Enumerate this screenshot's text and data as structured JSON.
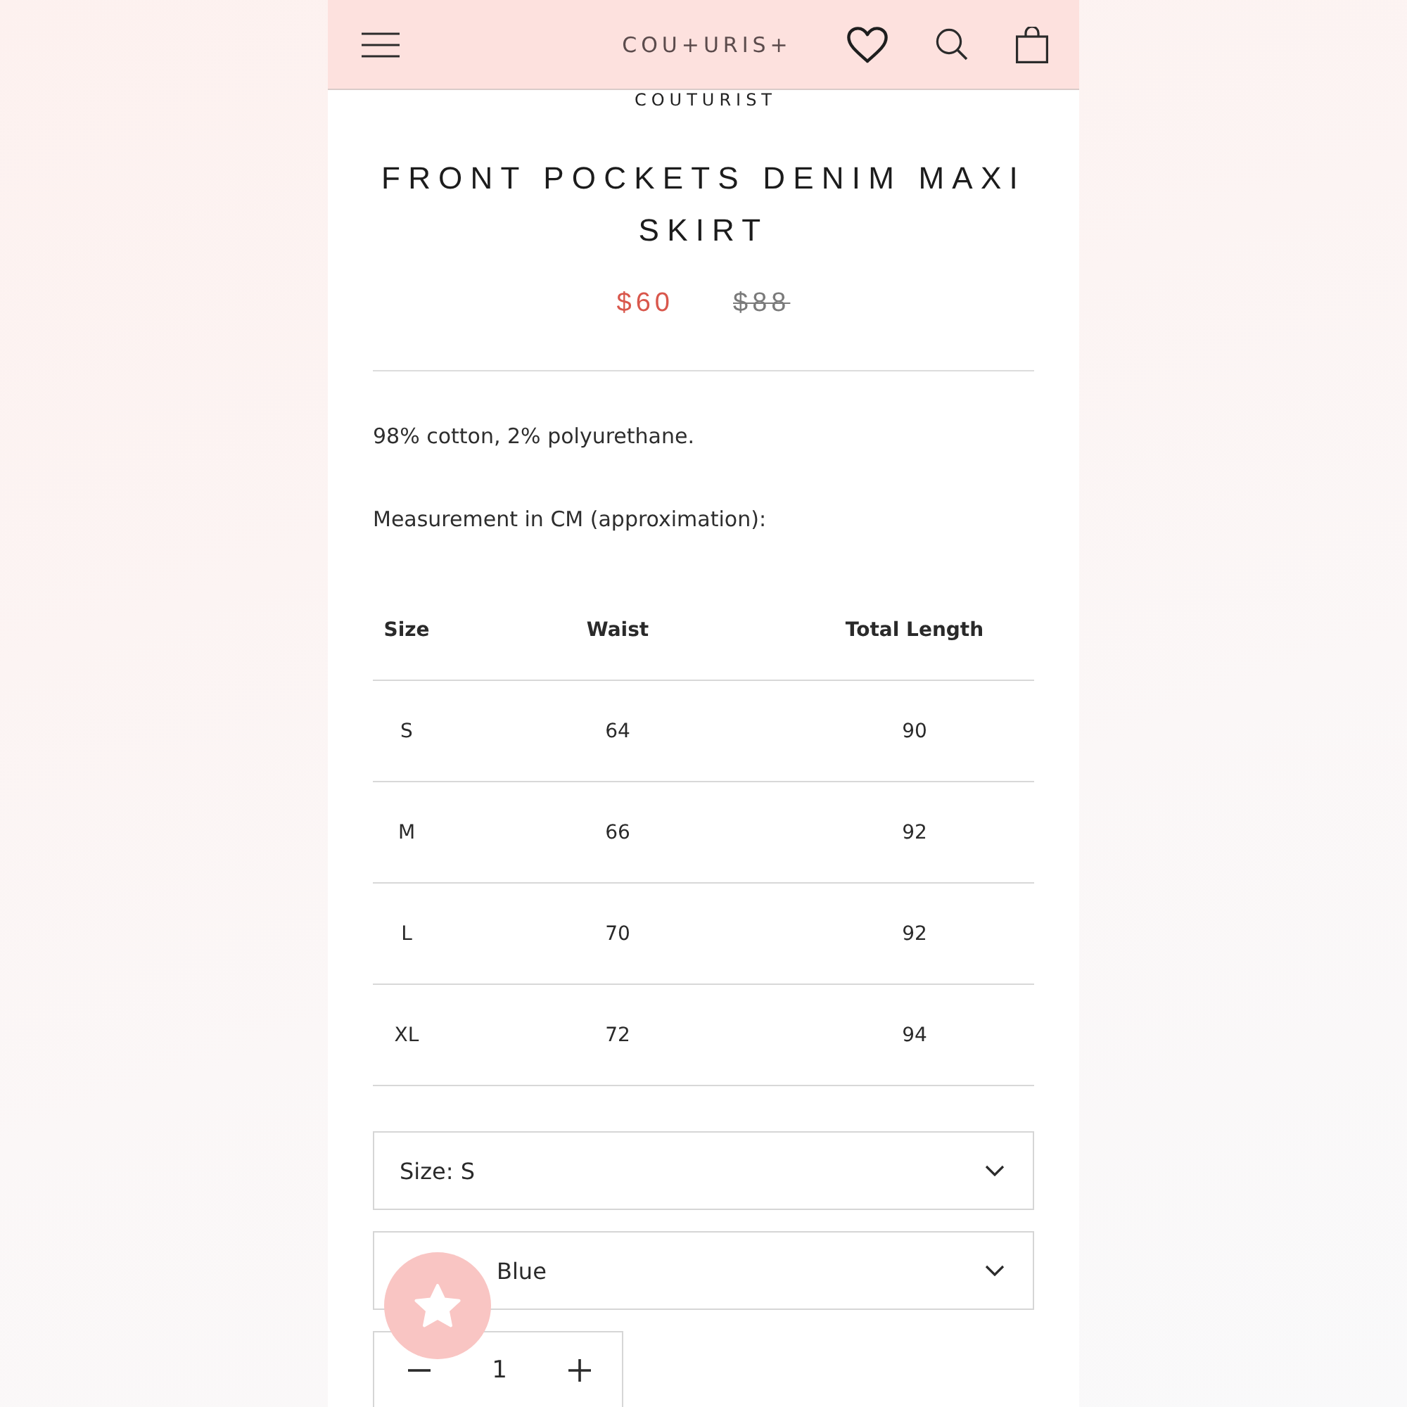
{
  "header": {
    "logo": "COU+URIS+"
  },
  "vendor": "COUTURIST",
  "product": {
    "title": "FRONT POCKETS DENIM MAXI SKIRT",
    "price": "$60",
    "compare_price": "$88"
  },
  "description": [
    "98% cotton, 2% polyurethane.",
    "Measurement in CM (approximation):"
  ],
  "size_table": {
    "columns": [
      "Size",
      "Waist",
      "Total Length"
    ],
    "rows": [
      [
        "S",
        "64",
        "90"
      ],
      [
        "M",
        "66",
        "92"
      ],
      [
        "L",
        "70",
        "92"
      ],
      [
        "XL",
        "72",
        "94"
      ]
    ]
  },
  "options": [
    {
      "value": "Size: S"
    },
    {
      "value": "Blue"
    }
  ],
  "quantity": {
    "value": "1"
  }
}
